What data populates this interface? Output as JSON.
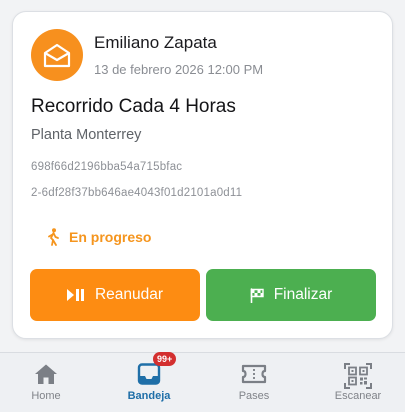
{
  "card": {
    "sender_name": "Emiliano Zapata",
    "date": "13 de febrero 2026 12:00 PM",
    "title": "Recorrido Cada 4 Horas",
    "location": "Planta Monterrey",
    "code_line_1": "698f66d2196bba54a715bfac",
    "code_line_2": "2-6df28f37bb646ae4043f01d2101a0d11",
    "status": "En progreso",
    "resume_label": "Reanudar",
    "finish_label": "Finalizar"
  },
  "nav": {
    "items": [
      {
        "label": "Home",
        "icon": "home-icon"
      },
      {
        "label": "Bandeja",
        "icon": "inbox-icon",
        "active": true
      },
      {
        "label": "Pases",
        "icon": "ticket-icon"
      },
      {
        "label": "Escanear",
        "icon": "qr-scan-icon"
      }
    ],
    "inbox_badge": "99+"
  },
  "colors": {
    "accent_orange": "#fd8c12",
    "status_orange": "#f5951e",
    "finish_green": "#4caf50",
    "active_nav": "#1f6fa8",
    "badge_red": "#d32f2f"
  }
}
